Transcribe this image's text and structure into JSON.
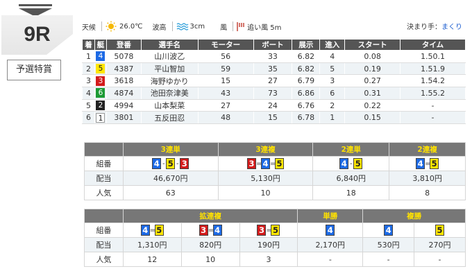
{
  "race": {
    "number": "9R",
    "name": "予選特賞"
  },
  "weather": {
    "condition_label": "天候",
    "condition_icon": "sun-icon",
    "temperature": "26.0℃",
    "wave_label": "波高",
    "wave_icon": "wave-icon",
    "wave": "3cm",
    "wind_label": "風",
    "wind_icon": "wind-flag-icon",
    "wind": "追い風 5m"
  },
  "kimarite": {
    "label": "決まり手：",
    "value": "まくり"
  },
  "result": {
    "headers": [
      "着",
      "艇",
      "登番",
      "選手名",
      "モーター",
      "ボート",
      "展示",
      "進入",
      "スタート",
      "タイム"
    ],
    "rows": [
      {
        "rank": "1",
        "boat": "4",
        "reg": "5078",
        "name": "山川波乙",
        "motor": "56",
        "boat_no": "33",
        "exhibit": "6.82",
        "course": "4",
        "start": "0.08",
        "time": "1.50.1"
      },
      {
        "rank": "2",
        "boat": "5",
        "reg": "4387",
        "name": "平山智加",
        "motor": "59",
        "boat_no": "35",
        "exhibit": "6.82",
        "course": "5",
        "start": "0.19",
        "time": "1.51.9"
      },
      {
        "rank": "3",
        "boat": "3",
        "reg": "3618",
        "name": "海野ゆかり",
        "motor": "15",
        "boat_no": "27",
        "exhibit": "6.79",
        "course": "3",
        "start": "0.27",
        "time": "1.54.2"
      },
      {
        "rank": "4",
        "boat": "6",
        "reg": "4874",
        "name": "池田奈津美",
        "motor": "43",
        "boat_no": "73",
        "exhibit": "6.86",
        "course": "6",
        "start": "0.31",
        "time": "1.55.2"
      },
      {
        "rank": "5",
        "boat": "2",
        "reg": "4994",
        "name": "山本梨菜",
        "motor": "27",
        "boat_no": "24",
        "exhibit": "6.76",
        "course": "2",
        "start": "0.22",
        "time": "-"
      },
      {
        "rank": "6",
        "boat": "1",
        "reg": "3801",
        "name": "五反田忍",
        "motor": "48",
        "boat_no": "15",
        "exhibit": "6.78",
        "course": "1",
        "start": "0.15",
        "time": "-"
      }
    ]
  },
  "payout_labels": {
    "combo": "組番",
    "payout": "配当",
    "popularity": "人気"
  },
  "payouts_top": [
    {
      "type": "3連単",
      "combo": [
        "4",
        "5",
        "3"
      ],
      "sep": "-",
      "payout": "46,670円",
      "popularity": "63"
    },
    {
      "type": "3連複",
      "combo": [
        "3",
        "4",
        "5"
      ],
      "sep": "=",
      "payout": "5,130円",
      "popularity": "10"
    },
    {
      "type": "2連単",
      "combo": [
        "4",
        "5"
      ],
      "sep": "-",
      "payout": "6,840円",
      "popularity": "18"
    },
    {
      "type": "2連複",
      "combo": [
        "4",
        "5"
      ],
      "sep": "=",
      "payout": "3,810円",
      "popularity": "8"
    }
  ],
  "payouts_bottom": {
    "wide_title": "拡連複",
    "wide": [
      {
        "combo": [
          "4",
          "5"
        ],
        "sep": "=",
        "payout": "1,310円",
        "popularity": "12"
      },
      {
        "combo": [
          "3",
          "4"
        ],
        "sep": "=",
        "payout": "820円",
        "popularity": "10"
      },
      {
        "combo": [
          "3",
          "5"
        ],
        "sep": "=",
        "payout": "190円",
        "popularity": "3"
      }
    ],
    "win_title": "単勝",
    "win": {
      "combo": [
        "4"
      ],
      "payout": "2,170円",
      "popularity": "-"
    },
    "place_title": "複勝",
    "place": [
      {
        "combo": [
          "4"
        ],
        "payout": "530円",
        "popularity": "-"
      },
      {
        "combo": [
          "5"
        ],
        "payout": "270円",
        "popularity": "-"
      }
    ]
  },
  "colors": {
    "lane1": "#ffffff",
    "lane2": "#222222",
    "lane3": "#d31b1b",
    "lane4": "#1d6ae5",
    "lane5": "#ffe600",
    "lane6": "#1c9a34",
    "header_gold": "#ffe100"
  }
}
